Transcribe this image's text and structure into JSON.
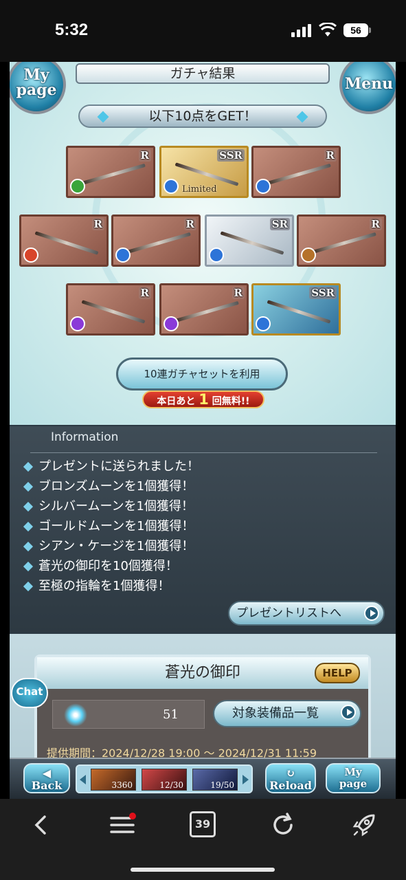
{
  "status": {
    "time": "5:32",
    "battery": "56"
  },
  "header": {
    "title": "ガチャ結果",
    "mypage_label": "My page",
    "menu_label": "Menu"
  },
  "results": {
    "banner": "以下10点をGET！",
    "items": [
      {
        "rarity": "R",
        "element": "wind",
        "color": "#3aa53a",
        "kind": "shield"
      },
      {
        "rarity": "SSR",
        "element": "water",
        "color": "#2d74d8",
        "kind": "limited summon",
        "label": "Limited"
      },
      {
        "rarity": "R",
        "element": "water",
        "color": "#2d74d8",
        "kind": "spear"
      },
      {
        "rarity": "R",
        "element": "fire",
        "color": "#d8452a",
        "kind": "spear"
      },
      {
        "rarity": "R",
        "element": "water",
        "color": "#2d74d8",
        "kind": "katana"
      },
      {
        "rarity": "SR",
        "element": "water",
        "color": "#2d74d8",
        "kind": "sword"
      },
      {
        "rarity": "R",
        "element": "earth",
        "color": "#b5722a",
        "kind": "pickaxe"
      },
      {
        "rarity": "R",
        "element": "dark",
        "color": "#8a3ad8",
        "kind": "summon"
      },
      {
        "rarity": "R",
        "element": "dark",
        "color": "#8a3ad8",
        "kind": "gun"
      },
      {
        "rarity": "SSR",
        "element": "water",
        "color": "#2d74d8",
        "kind": "summon"
      }
    ],
    "set_button": "10連ガチャセットを利用",
    "free_pre": "本日あと",
    "free_num": "1",
    "free_post": "回無料!!"
  },
  "info": {
    "title": "Information",
    "lines": [
      "プレゼントに送られました！",
      "ブロンズムーンを1個獲得！",
      "シルバームーンを1個獲得！",
      "ゴールドムーンを1個獲得！",
      "シアン・ケージを1個獲得！",
      "蒼光の御印を10個獲得！",
      "至極の指輪を1個獲得！"
    ],
    "present_list": "プレゼントリストへ"
  },
  "seal": {
    "title": "蒼光の御印",
    "help": "HELP",
    "count": "51",
    "target_button": "対象装備品一覧",
    "period": "提供期間：2024/12/28 19:00 〜 2024/12/31 11:59"
  },
  "chat": {
    "label": "Chat"
  },
  "bottom": {
    "back": "Back",
    "reload": "Reload",
    "mypage": "My page",
    "res1": "3360",
    "res2": "12/30",
    "res3": "19/50"
  },
  "browser": {
    "tab_count": "39"
  }
}
